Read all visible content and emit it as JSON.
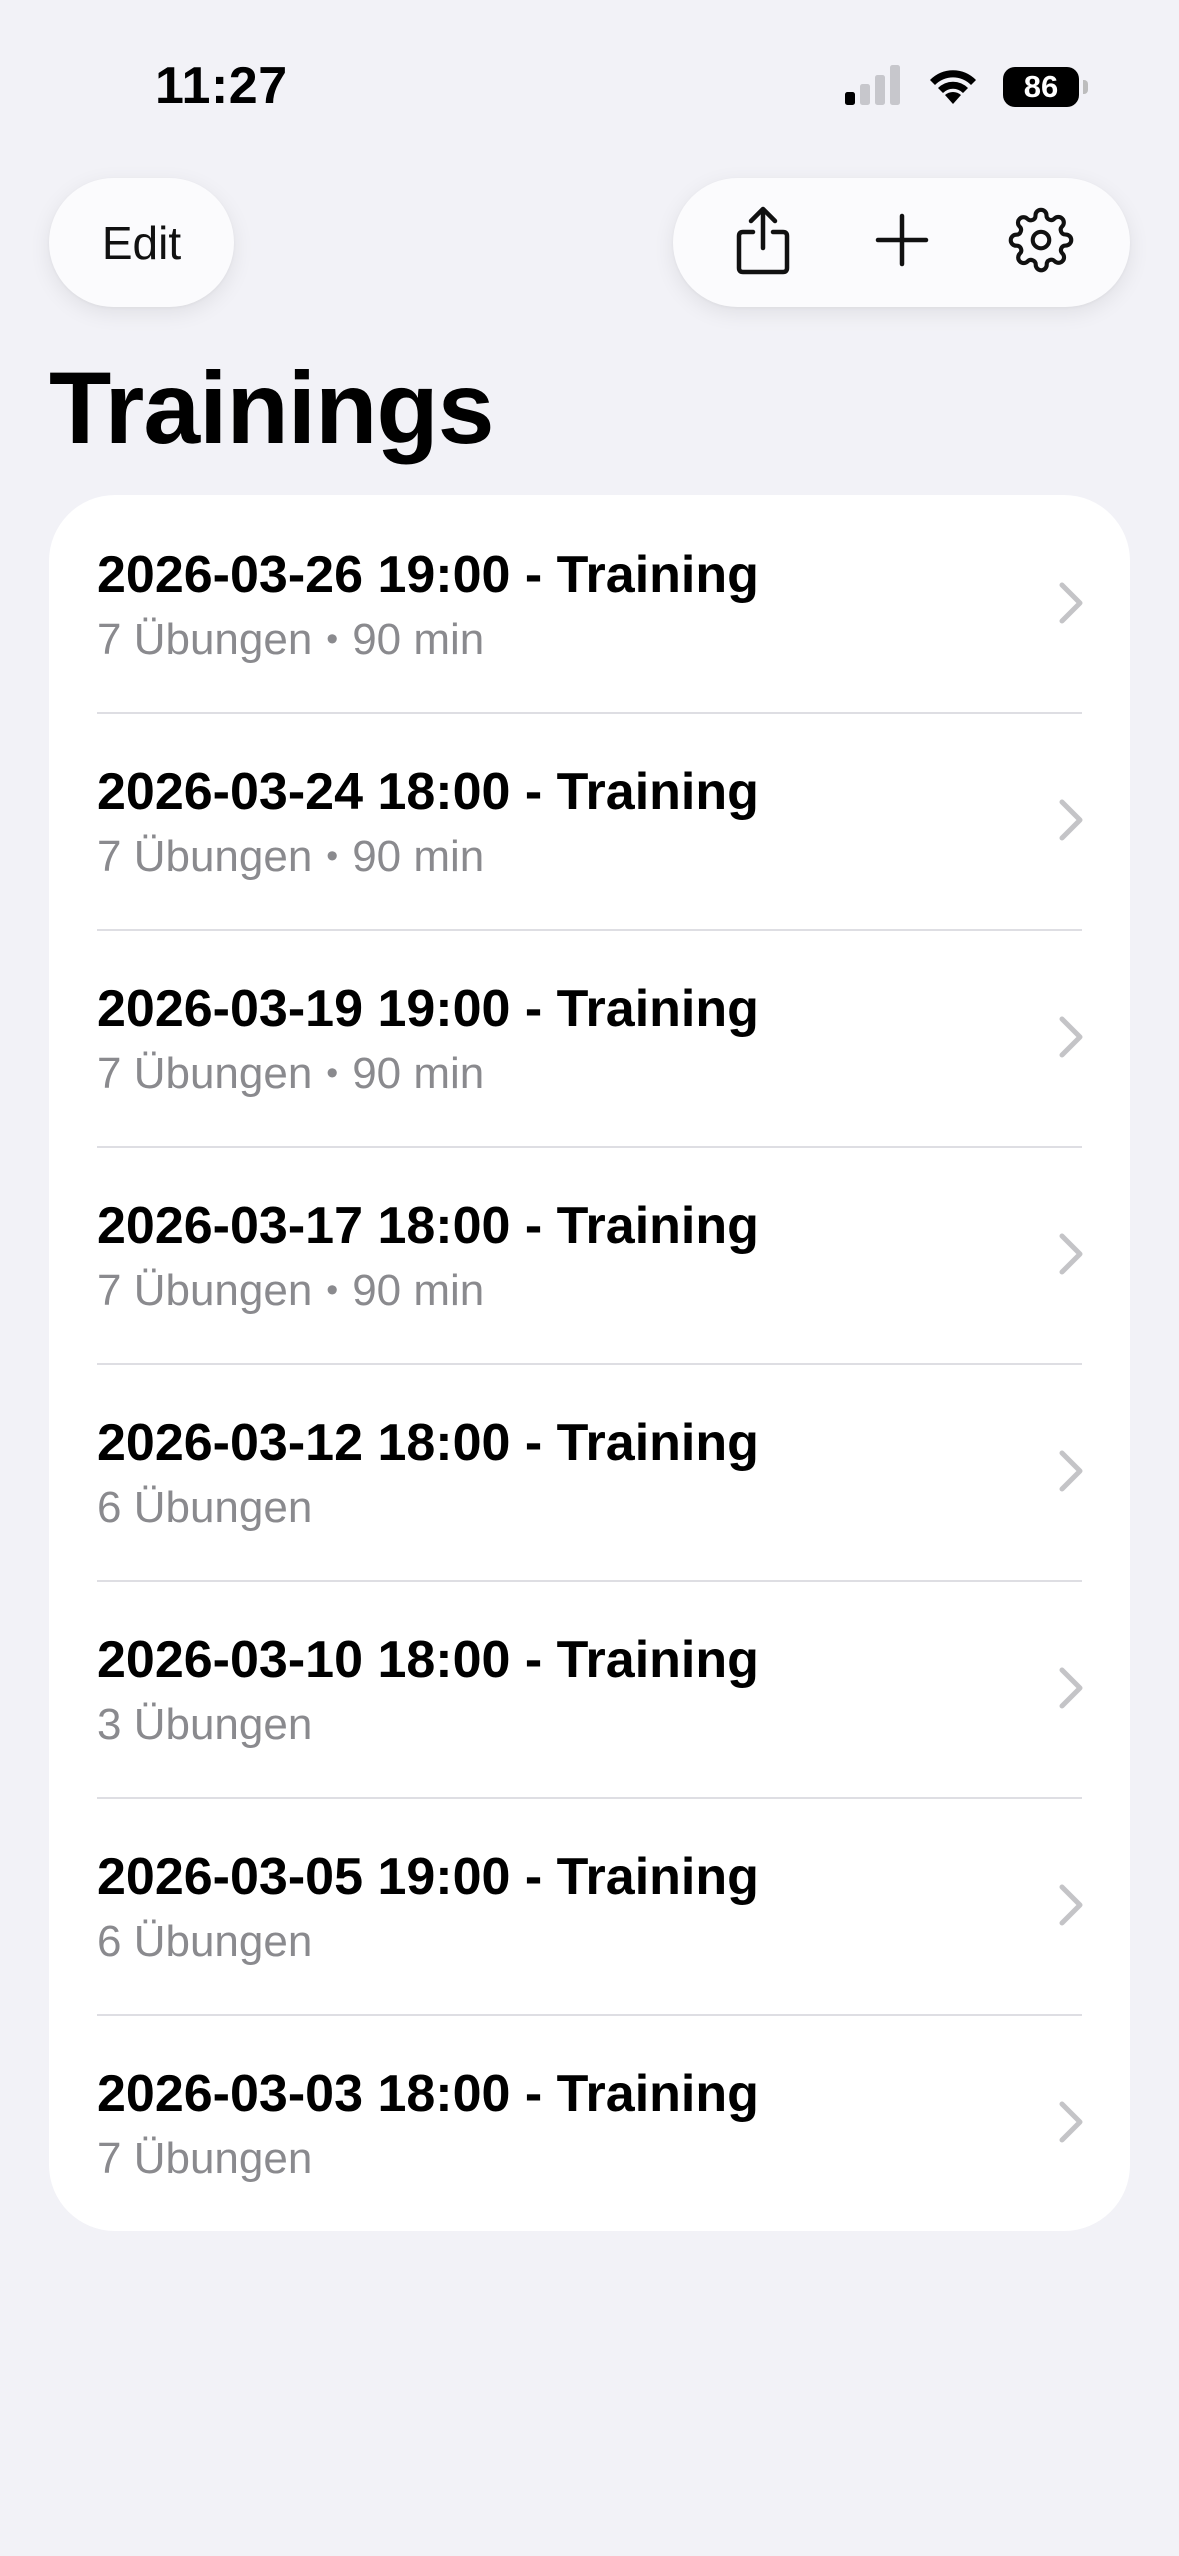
{
  "status_bar": {
    "time": "11:27",
    "battery": "86",
    "signal_icon": "cellular-signal-icon",
    "wifi_icon": "wifi-icon"
  },
  "toolbar": {
    "edit_label": "Edit",
    "share_icon": "share-icon",
    "add_icon": "plus-icon",
    "settings_icon": "gear-icon"
  },
  "page": {
    "title": "Trainings"
  },
  "trainings": [
    {
      "title": "2026-03-26 19:00 - Training",
      "exercises": "7 Übungen",
      "duration": "90 min"
    },
    {
      "title": "2026-03-24 18:00 - Training",
      "exercises": "7 Übungen",
      "duration": "90 min"
    },
    {
      "title": "2026-03-19 19:00 - Training",
      "exercises": "7 Übungen",
      "duration": "90 min"
    },
    {
      "title": "2026-03-17 18:00 - Training",
      "exercises": "7 Übungen",
      "duration": "90 min"
    },
    {
      "title": "2026-03-12 18:00 - Training",
      "exercises": "6 Übungen",
      "duration": null
    },
    {
      "title": "2026-03-10 18:00 - Training",
      "exercises": "3 Übungen",
      "duration": null
    },
    {
      "title": "2026-03-05 19:00 - Training",
      "exercises": "6 Übungen",
      "duration": null
    },
    {
      "title": "2026-03-03 18:00 - Training",
      "exercises": "7 Übungen",
      "duration": null
    }
  ],
  "colors": {
    "background": "#f2f2f7",
    "card": "#ffffff",
    "secondary_text": "#8a8a8e",
    "chevron": "#c4c4c7"
  }
}
